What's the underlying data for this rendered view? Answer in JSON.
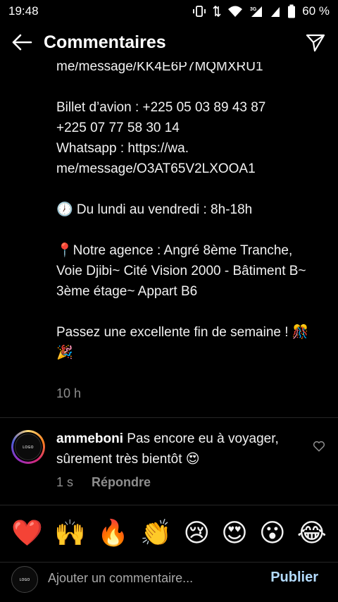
{
  "status_bar": {
    "time": "19:48",
    "network": "3G",
    "battery": "60 %"
  },
  "header": {
    "title": "Commentaires"
  },
  "caption": {
    "text": "me/message/KK4E6P7MQMXRU1\n\nBillet d’avion : +225 05 03 89 43 87\n+225 07 77 58 30 14\nWhatsapp : https://wa.\nme/message/O3AT65V2LXOOA1\n\n🕖 Du lundi au vendredi : 8h-18h\n\n📍Notre agence : Angré 8ème Tranche, Voie Djibi~ Cité Vision 2000 - Bâtiment B~ 3ème étage~ Appart B6\n\nPassez une excellente fin de semaine ! 🎊🎉",
    "time": "10 h"
  },
  "comment": {
    "username": "ammeboni",
    "text": " Pas encore eu à voyager, sûrement très bientôt 😍",
    "time": "1 s",
    "reply_label": "Répondre",
    "avatar_text": "ʟᴏɢᴏ"
  },
  "emoji_bar": [
    "❤️",
    "🙌",
    "🔥",
    "👏",
    "😢",
    "😍",
    "😮",
    "😂"
  ],
  "compose": {
    "placeholder": "Ajouter un commentaire...",
    "publish_label": "Publier",
    "avatar_text": "ʟᴏɢᴏ"
  },
  "colors": {
    "background": "#000000",
    "secondary_text": "#8e8e8e",
    "publish": "#b3dbff"
  }
}
